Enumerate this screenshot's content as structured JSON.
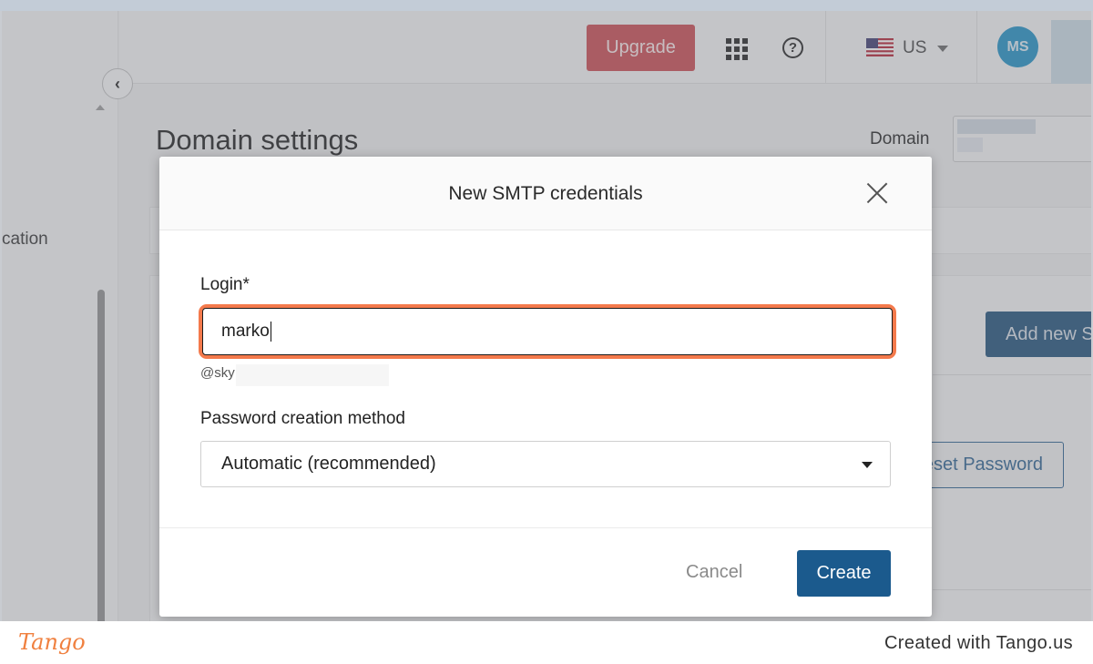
{
  "header": {
    "upgrade_label": "Upgrade",
    "language": "US",
    "avatar_initials": "MS"
  },
  "sidebar": {
    "partial_label": "cation"
  },
  "page": {
    "title": "Domain settings",
    "domain_label": "Domain",
    "add_new_button_label": "Add new S",
    "reset_password_button_label": "eset Password"
  },
  "modal": {
    "title": "New SMTP credentials",
    "login_label": "Login*",
    "login_value": "marko",
    "login_suffix": "@sky",
    "password_method_label": "Password creation method",
    "password_method_value": "Automatic (recommended)",
    "cancel_label": "Cancel",
    "create_label": "Create"
  },
  "footer": {
    "logo_text": "Tango",
    "created_with": "Created with Tango.us"
  },
  "colors": {
    "upgrade": "#c84a4f",
    "primary": "#1b5a8d",
    "highlight": "#f47a4c",
    "avatar": "#1f8ec2"
  },
  "icons": [
    "chevron-left-icon",
    "apps-grid-icon",
    "help-icon",
    "us-flag-icon",
    "caret-down-icon",
    "close-icon"
  ]
}
